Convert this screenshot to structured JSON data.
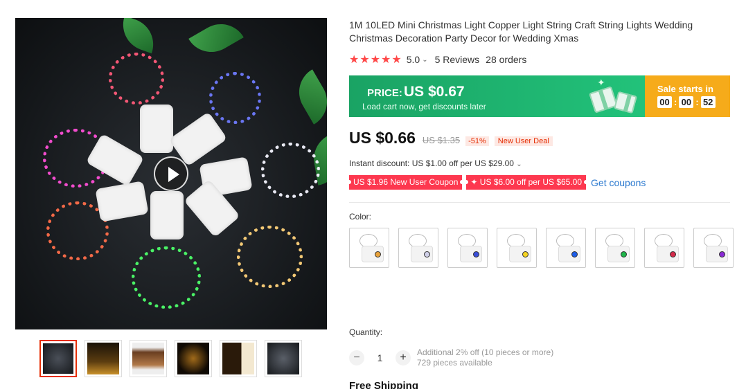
{
  "product": {
    "title": "1M 10LED Mini Christmas Light Copper Light String Craft String Lights Wedding Christmas Decoration Party Decor for Wedding Xmas",
    "rating": {
      "stars": "★★★★★",
      "value": "5.0",
      "reviews": "5 Reviews",
      "orders": "28 orders"
    }
  },
  "promo": {
    "price_label": "PRICE:",
    "price": "US $0.67",
    "subtext": "Load cart now, get discounts later",
    "sale_label": "Sale starts in",
    "countdown": {
      "hours": "00",
      "minutes": "00",
      "seconds": "52"
    },
    "colors": {
      "green": "#1aa364",
      "orange": "#f6ab1a"
    }
  },
  "price": {
    "current": "US $0.66",
    "original": "US $1.35",
    "discount": "-51%",
    "deal_badge": "New User Deal"
  },
  "instant_discount": "Instant discount: US $1.00 off per US $29.00",
  "coupons": [
    {
      "label": "US $1.96 New User Coupon"
    },
    {
      "label": "✦ US $6.00 off per US $65.00"
    }
  ],
  "get_coupons": "Get coupons",
  "color": {
    "label": "Color:",
    "options": [
      {
        "name": "warm white",
        "dot": "#e8a23a"
      },
      {
        "name": "white",
        "dot": "#d0d0e8"
      },
      {
        "name": "blue-white",
        "dot": "#3a4fd8"
      },
      {
        "name": "yellow",
        "dot": "#f5d422"
      },
      {
        "name": "blue",
        "dot": "#1e5ee8"
      },
      {
        "name": "green",
        "dot": "#1fb54a"
      },
      {
        "name": "red",
        "dot": "#d42a4a"
      },
      {
        "name": "purple",
        "dot": "#8a2ad4"
      }
    ]
  },
  "quantity": {
    "label": "Quantity:",
    "value": "1",
    "minus": "−",
    "plus": "+",
    "additional": "Additional 2% off (10 pieces or more)",
    "available": "729 pieces available"
  },
  "shipping": "Free Shipping",
  "icons": {
    "play": "play-icon",
    "chevron": "chevron-down-icon"
  }
}
